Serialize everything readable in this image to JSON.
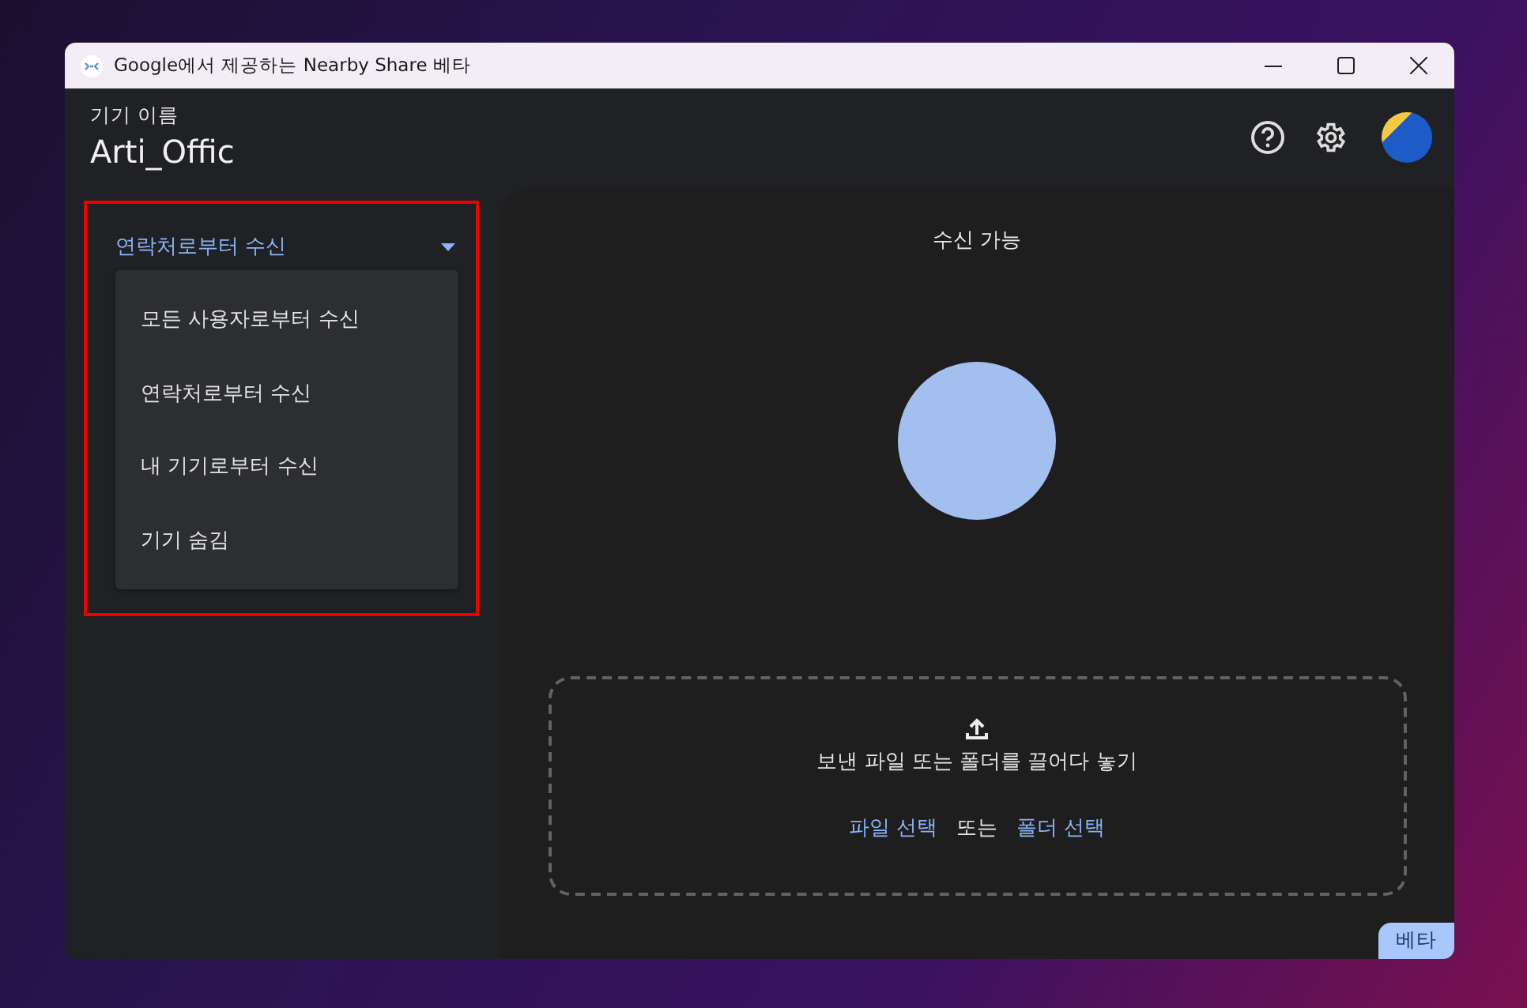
{
  "window": {
    "title": "Google에서 제공하는 Nearby Share 베타"
  },
  "header": {
    "label": "기기 이름",
    "device_name": "Arti_Offic"
  },
  "visibility": {
    "value": "연락처로부터 수신",
    "expanded": true,
    "options": [
      {
        "label": "모든 사용자로부터 수신"
      },
      {
        "label": "연락처로부터 수신"
      },
      {
        "label": "내 기기로부터 수신"
      },
      {
        "label": "기기 숨김"
      }
    ]
  },
  "status": "수신 가능",
  "drop_zone": {
    "text": "보낸 파일 또는 폴더를 끌어다 놓기",
    "file_link": "파일 선택",
    "separator": "또는",
    "folder_link": "폴더 선택"
  },
  "badge": "베타"
}
